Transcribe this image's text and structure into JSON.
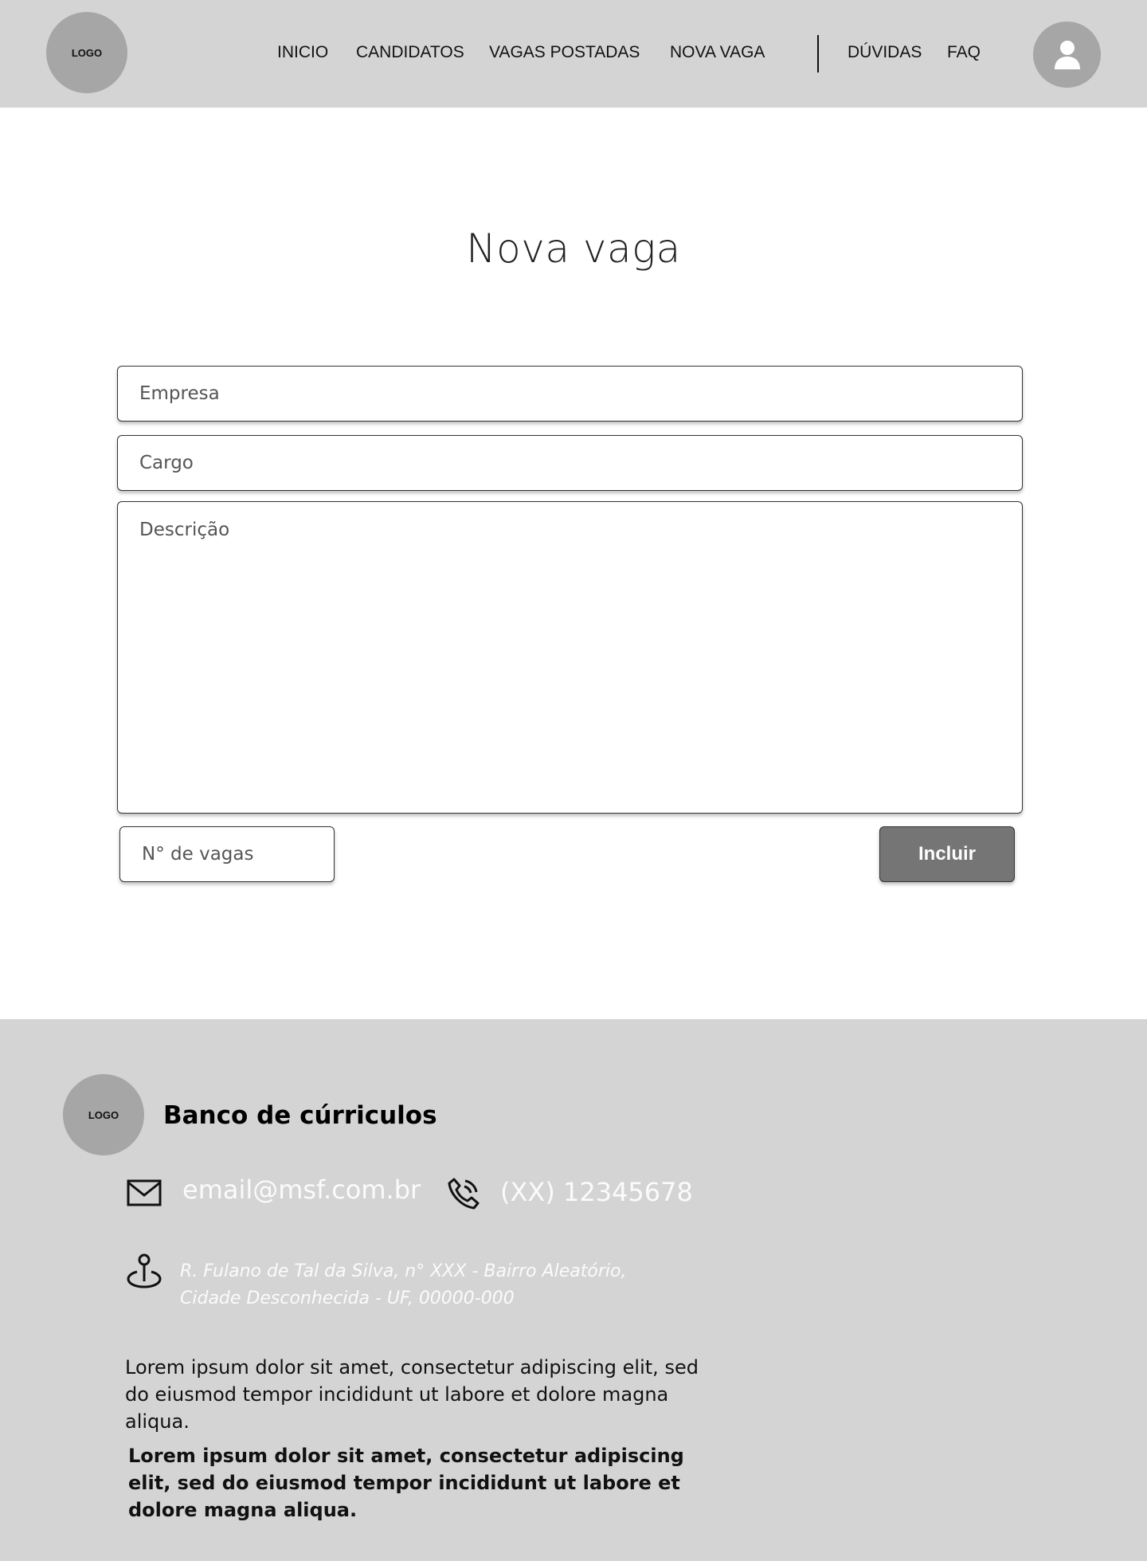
{
  "header": {
    "logo_text": "LOGO",
    "nav": [
      {
        "label": "INICIO"
      },
      {
        "label": "CANDIDATOS"
      },
      {
        "label": "VAGAS POSTADAS"
      },
      {
        "label": "NOVA VAGA"
      },
      {
        "label": "DÚVIDAS"
      },
      {
        "label": "FAQ"
      }
    ],
    "avatar_icon": "user-icon"
  },
  "main": {
    "title": "Nova vaga",
    "form": {
      "empresa_placeholder": "Empresa",
      "cargo_placeholder": "Cargo",
      "descricao_placeholder": "Descrição",
      "vagas_placeholder": "N° de vagas",
      "submit_label": "Incluir"
    }
  },
  "footer": {
    "logo_text": "LOGO",
    "brand": "Banco de cúrriculos",
    "email": "email@msf.com.br",
    "phone": "(XX) 12345678",
    "address_line1": "R. Fulano de Tal da Silva, n° XXX - Bairro Aleatório,",
    "address_line2": "Cidade Desconhecida - UF, 00000-000",
    "paragraph": "Lorem ipsum dolor sit amet, consectetur adipiscing elit, sed do eiusmod tempor incididunt ut labore et dolore magna aliqua.",
    "paragraph_bold": "Lorem ipsum dolor sit amet, consectetur adipiscing elit, sed do eiusmod tempor incididunt ut labore et dolore magna aliqua.",
    "icons": [
      "mail-icon",
      "phone-icon",
      "location-pin-icon"
    ]
  },
  "colors": {
    "header_bg": "#d4d4d4",
    "logo_bg": "#a6a6a6",
    "button_bg": "#757575",
    "footer_bg": "#d4d4d4"
  }
}
